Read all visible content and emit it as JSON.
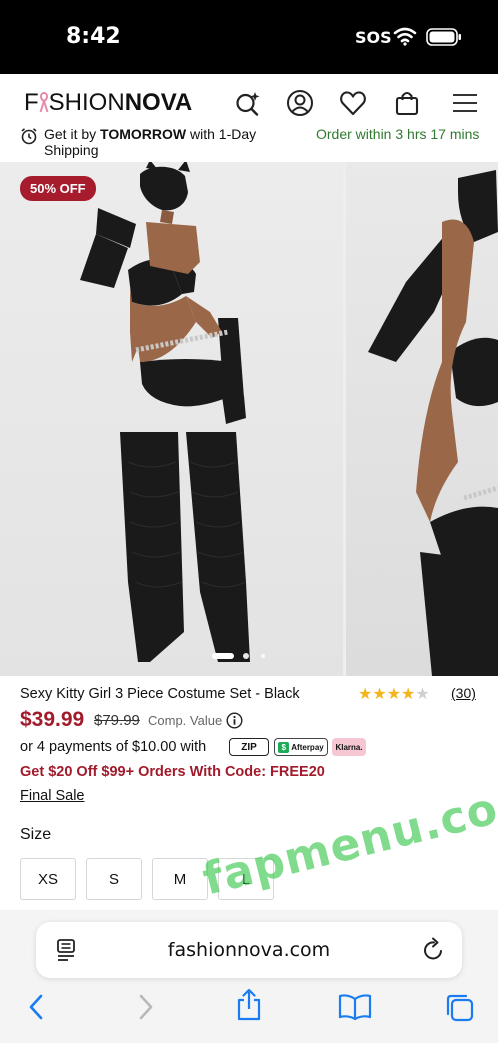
{
  "status_bar": {
    "time": "8:42",
    "sos": "SOS"
  },
  "header": {
    "logo_part1": "F",
    "logo_part2": "SHION",
    "logo_part3": "NOVA",
    "icons": [
      "search-sparkle-icon",
      "account-icon",
      "heart-icon",
      "bag-icon",
      "menu-icon"
    ]
  },
  "shipping": {
    "prefix": "Get it by ",
    "highlight": "TOMORROW",
    "suffix": " with 1-Day Shipping",
    "order_within": "Order within 3 hrs 17 mins"
  },
  "gallery": {
    "badge": "50% OFF",
    "slide_count": 3,
    "active_slide": 0
  },
  "product": {
    "title": "Sexy Kitty Girl 3 Piece Costume Set - Black",
    "rating": 4,
    "rating_max": 5,
    "review_count": "(30)",
    "sale_price": "$39.99",
    "original_price": "$79.99",
    "comp_value_label": "Comp. Value",
    "installments_text": "or 4 payments of $10.00 with",
    "pay_options": [
      "zip",
      "Afterpay",
      "Klarna."
    ],
    "promo": "Get $20 Off $99+ Orders With Code: FREE20",
    "final_sale": "Final Sale",
    "size_label": "Size",
    "sizes": [
      "XS",
      "S",
      "M",
      "L"
    ]
  },
  "browser": {
    "url": "fashionnova.com",
    "toolbar_icons": [
      "back-icon",
      "forward-icon",
      "share-icon",
      "bookmarks-icon",
      "tabs-icon"
    ]
  },
  "watermark": "fapmenu.com",
  "colors": {
    "accent_red": "#a11b2b",
    "badge_red": "#a71c2c",
    "green_text": "#2f7a2f",
    "star": "#f3b51b"
  }
}
